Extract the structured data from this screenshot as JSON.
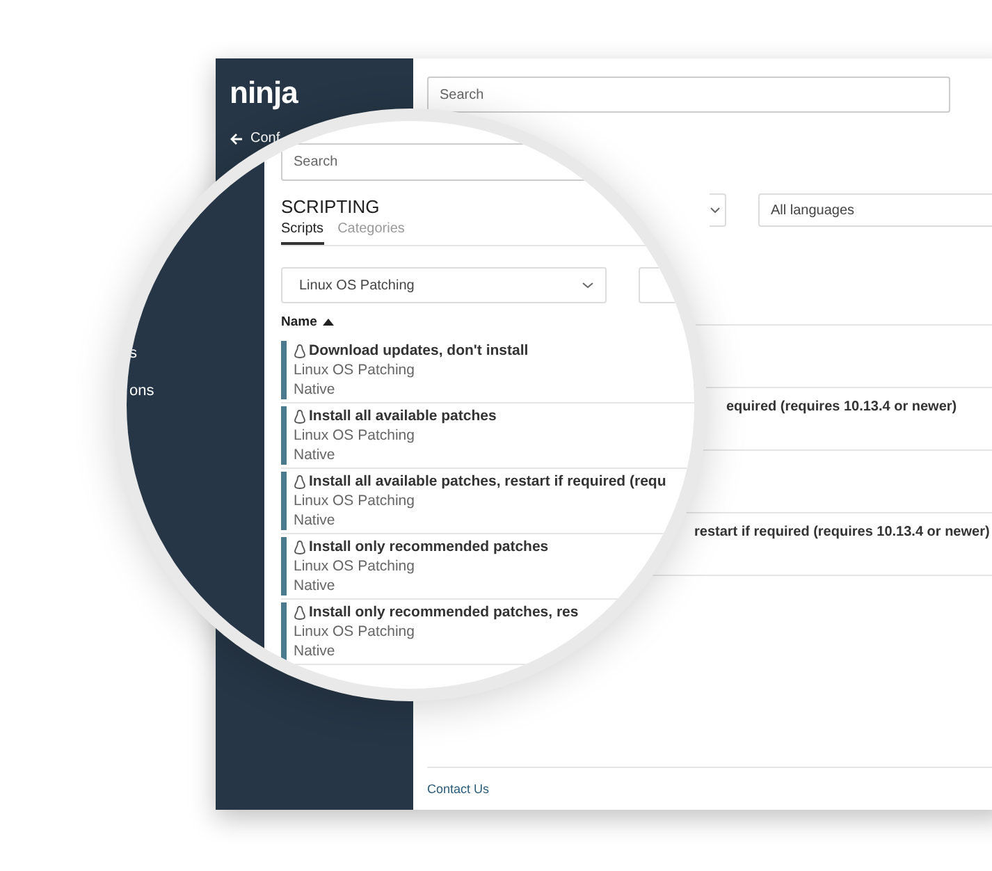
{
  "sidebar": {
    "logo": "ninja",
    "back_label": "Conf"
  },
  "search": {
    "placeholder": "Search"
  },
  "filters": [
    {
      "kind": "blank"
    },
    {
      "kind": "select",
      "value": "All languages"
    }
  ],
  "background_rows": [
    {
      "name": "equired (requires 10.13.4 or newer)"
    },
    {
      "name": "restart if required (requires 10.13.4 or newer)"
    }
  ],
  "footer": {
    "link": "Contact Us"
  },
  "magnifier": {
    "sidebar_items": [
      "s",
      "ons"
    ],
    "search": {
      "placeholder": "Search"
    },
    "title": "SCRIPTING",
    "tabs": [
      {
        "label": "Scripts",
        "selected": true
      },
      {
        "label": "Categories",
        "selected": false
      }
    ],
    "category_filter": {
      "value": "Linux OS Patching"
    },
    "sort_column": {
      "label": "Name"
    },
    "scripts": [
      {
        "name": "Download updates, don't install",
        "category": "Linux OS Patching",
        "language": "Native"
      },
      {
        "name": "Install all available patches",
        "category": "Linux OS Patching",
        "language": "Native"
      },
      {
        "name": "Install all available patches, restart if required (requ",
        "category": "Linux OS Patching",
        "language": "Native"
      },
      {
        "name": "Install only recommended patches",
        "category": "Linux OS Patching",
        "language": "Native"
      },
      {
        "name": "Install only recommended patches, res",
        "category": "Linux OS Patching",
        "language": "Native"
      }
    ]
  }
}
